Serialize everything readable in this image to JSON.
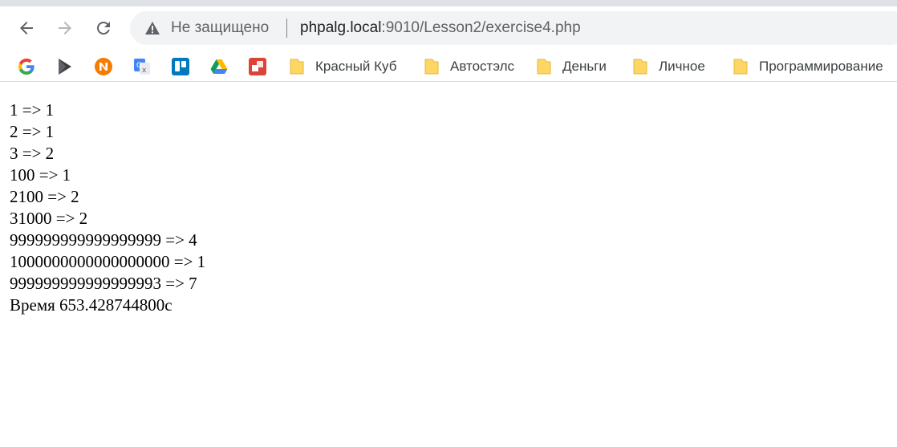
{
  "browser": {
    "nav": {
      "back_icon": "arrow-left-icon",
      "forward_icon": "arrow-right-icon",
      "reload_icon": "reload-icon"
    },
    "omnibox": {
      "security_icon": "warning-triangle-icon",
      "security_text": "Не защищено",
      "url_host": "phpalg.local",
      "url_rest": ":9010/Lesson2/exercise4.php"
    },
    "bookmarks": {
      "icons": [
        "google-icon",
        "play-icon",
        "n-logo-icon",
        "translate-icon",
        "trello-icon",
        "drive-icon",
        "red-app-icon"
      ],
      "folders": [
        "Красный Куб",
        "Автостэлс",
        "Деньги",
        "Личное",
        "Программирование"
      ]
    }
  },
  "page": {
    "lines": [
      "1 => 1",
      "2 => 1",
      "3 => 2",
      "100 => 1",
      "2100 => 2",
      "31000 => 2",
      "999999999999999999 => 4",
      "1000000000000000000 => 1",
      "999999999999999993 => 7",
      "Время 653.428744800с"
    ]
  },
  "colors": {
    "toolbar_bg": "#ffffff",
    "omnibox_bg": "#f1f3f4",
    "folder_yellow": "#fdd663",
    "text_secondary": "#5f6368"
  }
}
